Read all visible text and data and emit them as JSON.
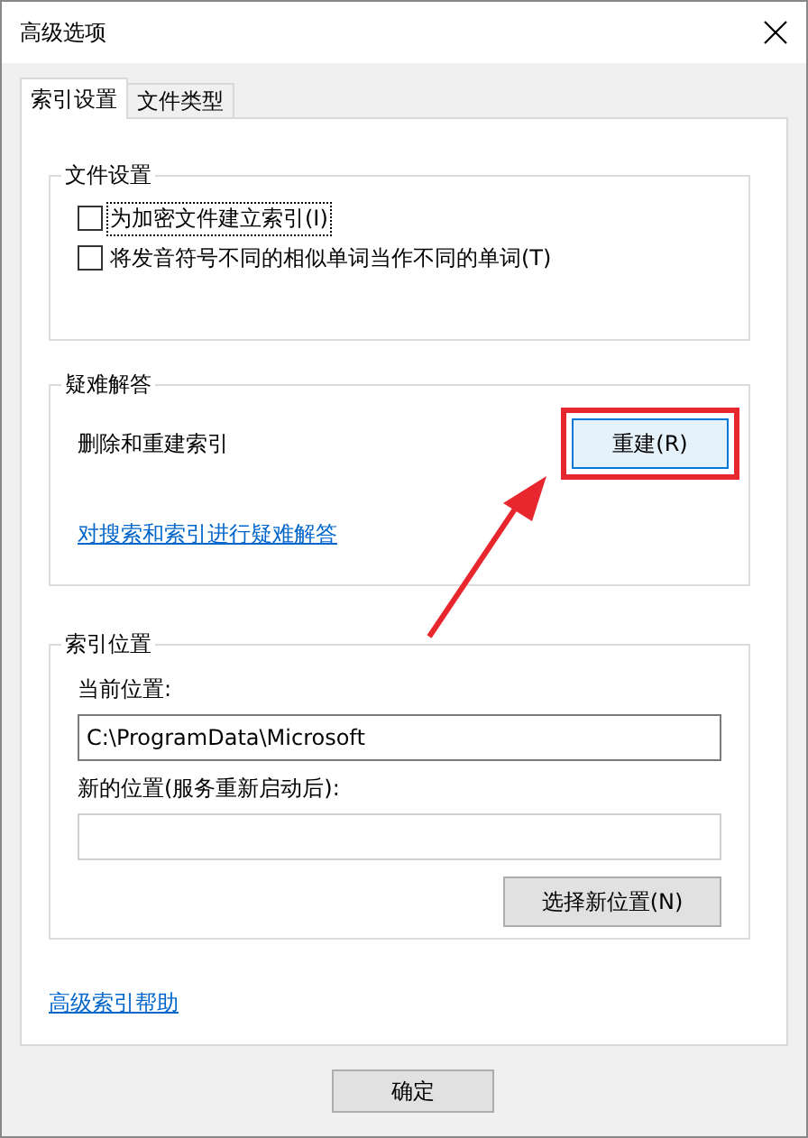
{
  "window": {
    "title": "高级选项"
  },
  "tabs": [
    {
      "label": "索引设置",
      "selected": true
    },
    {
      "label": "文件类型",
      "selected": false
    }
  ],
  "file_settings": {
    "title": "文件设置",
    "options": [
      {
        "label": "为加密文件建立索引(I)",
        "checked": false,
        "focused": true
      },
      {
        "label": "将发音符号不同的相似单词当作不同的单词(T)",
        "checked": false,
        "focused": false
      }
    ]
  },
  "troubleshooting": {
    "title": "疑难解答",
    "description": "删除和重建索引",
    "rebuild_button": "重建(R)",
    "link": "对搜索和索引进行疑难解答"
  },
  "index_location": {
    "title": "索引位置",
    "current_label": "当前位置:",
    "current_value": "C:\\ProgramData\\Microsoft",
    "new_label": "新的位置(服务重新启动后):",
    "select_button": "选择新位置(N)"
  },
  "help_link": "高级索引帮助",
  "buttons": [
    "确定"
  ]
}
